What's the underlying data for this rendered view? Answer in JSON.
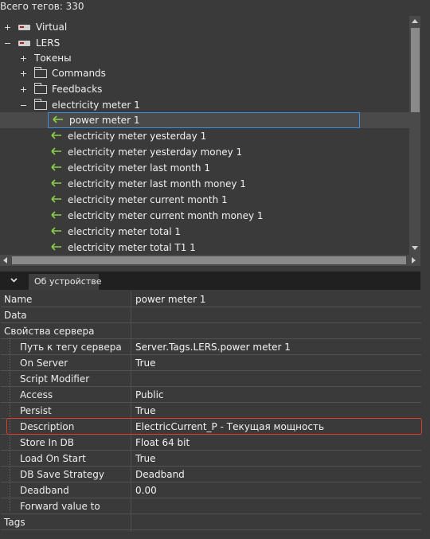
{
  "header": {
    "total_tags": "Всего тегов: 330"
  },
  "tree": {
    "items": [
      {
        "label": "Virtual"
      },
      {
        "label": "LERS"
      },
      {
        "label": "Токены"
      },
      {
        "label": "Commands"
      },
      {
        "label": "Feedbacks"
      },
      {
        "label": "electricity meter 1"
      },
      {
        "label": "power meter 1"
      },
      {
        "label": "electricity meter yesterday 1"
      },
      {
        "label": "electricity meter yesterday money 1"
      },
      {
        "label": "electricity meter last month 1"
      },
      {
        "label": "electricity meter last month money 1"
      },
      {
        "label": "electricity meter current month 1"
      },
      {
        "label": "electricity meter current month money 1"
      },
      {
        "label": "electricity meter total 1"
      },
      {
        "label": "electricity meter total T1 1"
      }
    ]
  },
  "panel": {
    "tab_label": "Об устройстве",
    "properties": [
      {
        "key": "Name",
        "value": "power meter 1"
      },
      {
        "key": "Data",
        "value": ""
      },
      {
        "key": "Свойства сервера",
        "value": ""
      },
      {
        "key": "Путь к тегу сервера",
        "value": "Server.Tags.LERS.power meter 1"
      },
      {
        "key": "On Server",
        "value": "True"
      },
      {
        "key": "Script Modifier",
        "value": ""
      },
      {
        "key": "Access",
        "value": "Public"
      },
      {
        "key": "Persist",
        "value": "True"
      },
      {
        "key": "Description",
        "value": "ElectricCurrent_P - Текущая мощность"
      },
      {
        "key": "Store In DB",
        "value": "Float 64 bit"
      },
      {
        "key": "Load On Start",
        "value": "True"
      },
      {
        "key": "DB Save Strategy",
        "value": "Deadband"
      },
      {
        "key": "Deadband",
        "value": "0.00"
      },
      {
        "key": "Forward value to",
        "value": ""
      },
      {
        "key": "Tags",
        "value": ""
      }
    ]
  },
  "colors": {
    "accent_green": "#8ccf4a",
    "selection_border": "#3f8fdf",
    "highlight_red": "#e03a2f"
  }
}
